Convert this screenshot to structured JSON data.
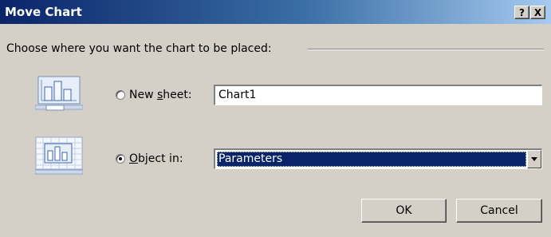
{
  "window": {
    "title": "Move Chart",
    "help_glyph": "?",
    "close_glyph": "X"
  },
  "group": {
    "label": "Choose where you want the chart to be placed:"
  },
  "new_sheet": {
    "label_prefix": "New ",
    "label_accel": "s",
    "label_suffix": "heet:",
    "selected": false,
    "value": "Chart1",
    "icon": "new-sheet-chart-icon"
  },
  "object_in": {
    "label_prefix": "",
    "label_accel": "O",
    "label_suffix": "bject in:",
    "selected": true,
    "value": "Parameters",
    "icon": "embedded-chart-icon"
  },
  "buttons": {
    "ok": "OK",
    "cancel": "Cancel"
  },
  "colors": {
    "title_gradient_start": "#0a246a",
    "title_gradient_end": "#a6caf0",
    "dialog_face": "#d4d0c8",
    "selection": "#0a246a"
  }
}
